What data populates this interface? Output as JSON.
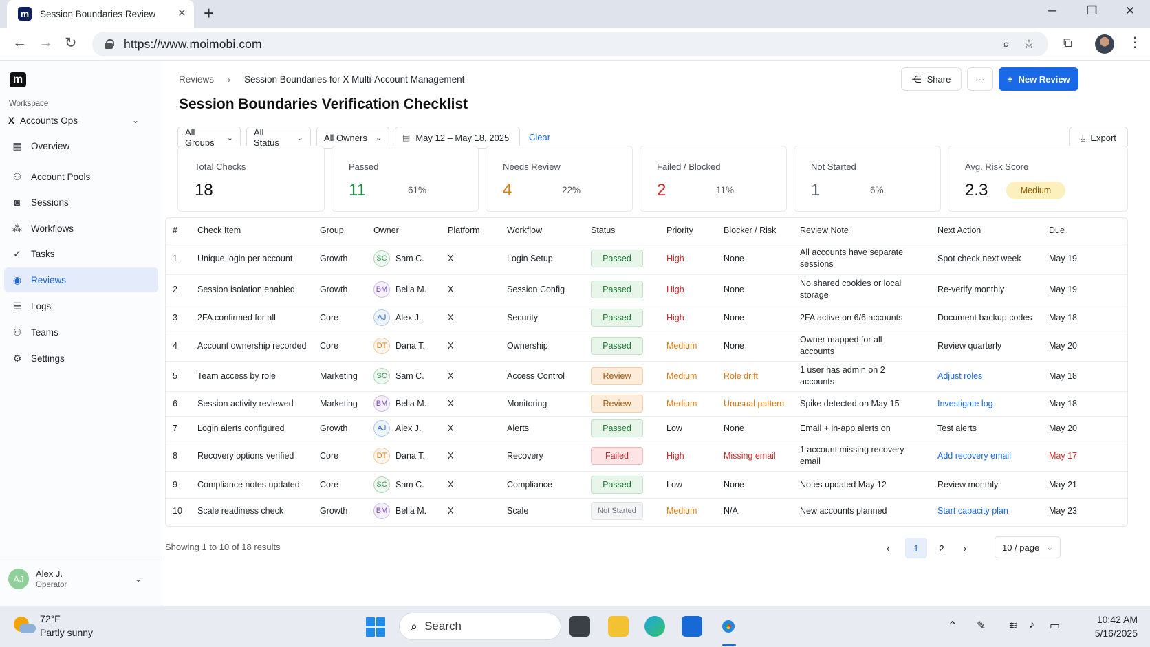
{
  "browser": {
    "tab_title": "Session Boundaries Review",
    "url": "https://www.moimobi.com",
    "favicon_letter": "m"
  },
  "sidebar": {
    "logo_letter": "m",
    "workspace_label": "Workspace",
    "workspace_name": "Accounts Ops",
    "workspace_prefix": "X",
    "items": [
      {
        "label": "Overview",
        "icon": "grid-icon"
      },
      {
        "label": "Account Pools",
        "icon": "users-icon"
      },
      {
        "label": "Sessions",
        "icon": "session-icon"
      },
      {
        "label": "Workflows",
        "icon": "workflow-icon"
      },
      {
        "label": "Tasks",
        "icon": "check-circle-icon"
      },
      {
        "label": "Reviews",
        "icon": "review-icon",
        "active": true
      },
      {
        "label": "Logs",
        "icon": "log-icon"
      },
      {
        "label": "Teams",
        "icon": "team-icon"
      },
      {
        "label": "Settings",
        "icon": "gear-icon"
      }
    ],
    "user": {
      "initials": "AJ",
      "name": "Alex J.",
      "role": "Operator"
    }
  },
  "header": {
    "breadcrumb_root": "Reviews",
    "breadcrumb_current": "Session Boundaries for X Multi-Account Management",
    "title": "Session Boundaries Verification Checklist",
    "share_label": "Share",
    "more_label": "···",
    "new_review_label": "New Review",
    "export_label": "Export"
  },
  "filters": {
    "groups": "All Groups",
    "status": "All Status",
    "owners": "All Owners",
    "date_range": "May 12 – May 18, 2025",
    "clear": "Clear"
  },
  "summary": [
    {
      "label": "Total Checks",
      "value": "18",
      "pct": "",
      "color": "#111111"
    },
    {
      "label": "Passed",
      "value": "11",
      "pct": "61%",
      "color": "#1b8a3a"
    },
    {
      "label": "Needs Review",
      "value": "4",
      "pct": "22%",
      "color": "#e07b12"
    },
    {
      "label": "Failed / Blocked",
      "value": "2",
      "pct": "11%",
      "color": "#d42a2a"
    },
    {
      "label": "Not Started",
      "value": "1",
      "pct": "6%",
      "color": "#5a6270"
    },
    {
      "label": "Avg. Risk Score",
      "value": "2.3",
      "badge": "Medium",
      "color": "#111111"
    }
  ],
  "table": {
    "columns": [
      "#",
      "Check Item",
      "Group",
      "Owner",
      "Platform",
      "Workflow",
      "Status",
      "Priority",
      "Blocker / Risk",
      "Review Note",
      "Next Action",
      "Due"
    ],
    "rows": [
      {
        "n": "1",
        "item": "Unique login per account",
        "group": "Growth",
        "initials": "SC",
        "owner": "Sam C.",
        "platform": "X",
        "workflow": "Login Setup",
        "status": "Passed",
        "status_class": "passed",
        "priority": "High",
        "blocker": "None",
        "note": "All accounts have separate sessions",
        "action": "Spot check next week",
        "action_link": false,
        "due": "May 19",
        "due_alert": false
      },
      {
        "n": "2",
        "item": "Session isolation enabled",
        "group": "Growth",
        "initials": "BM",
        "owner": "Bella M.",
        "platform": "X",
        "workflow": "Session Config",
        "status": "Passed",
        "status_class": "passed",
        "priority": "High",
        "blocker": "None",
        "note": "No shared cookies or local storage",
        "action": "Re-verify monthly",
        "action_link": false,
        "due": "May 19",
        "due_alert": false
      },
      {
        "n": "3",
        "item": "2FA confirmed for all",
        "group": "Core",
        "initials": "AJ",
        "owner": "Alex J.",
        "platform": "X",
        "workflow": "Security",
        "status": "Passed",
        "status_class": "passed",
        "priority": "High",
        "blocker": "None",
        "note": "2FA active on 6/6 accounts",
        "action": "Document backup codes",
        "action_link": false,
        "due": "May 18",
        "due_alert": false
      },
      {
        "n": "4",
        "item": "Account ownership recorded",
        "group": "Core",
        "initials": "DT",
        "owner": "Dana T.",
        "platform": "X",
        "workflow": "Ownership",
        "status": "Passed",
        "status_class": "passed",
        "priority": "Medium",
        "blocker": "None",
        "note": "Owner mapped for all accounts",
        "action": "Review quarterly",
        "action_link": false,
        "due": "May 20",
        "due_alert": false
      },
      {
        "n": "5",
        "item": "Team access by role",
        "group": "Marketing",
        "initials": "SC",
        "owner": "Sam C.",
        "platform": "X",
        "workflow": "Access Control",
        "status": "Review",
        "status_class": "review",
        "priority": "Medium",
        "blocker": "Role drift",
        "note": "1 user has admin on 2 accounts",
        "action": "Adjust roles",
        "action_link": true,
        "due": "May 18",
        "due_alert": false
      },
      {
        "n": "6",
        "item": "Session activity reviewed",
        "group": "Marketing",
        "initials": "BM",
        "owner": "Bella M.",
        "platform": "X",
        "workflow": "Monitoring",
        "status": "Review",
        "status_class": "review",
        "priority": "Medium",
        "blocker": "Unusual pattern",
        "note": "Spike detected on May 15",
        "action": "Investigate log",
        "action_link": true,
        "due": "May 18",
        "due_alert": false
      },
      {
        "n": "7",
        "item": "Login alerts configured",
        "group": "Growth",
        "initials": "AJ",
        "owner": "Alex J.",
        "platform": "X",
        "workflow": "Alerts",
        "status": "Passed",
        "status_class": "passed",
        "priority": "Low",
        "blocker": "None",
        "note": "Email + in-app alerts on",
        "action": "Test alerts",
        "action_link": false,
        "due": "May 20",
        "due_alert": false
      },
      {
        "n": "8",
        "item": "Recovery options verified",
        "group": "Core",
        "initials": "DT",
        "owner": "Dana T.",
        "platform": "X",
        "workflow": "Recovery",
        "status": "Failed",
        "status_class": "failed",
        "priority": "High",
        "blocker": "Missing email",
        "note": "1 account missing recovery email",
        "action": "Add recovery email",
        "action_link": true,
        "due": "May 17",
        "due_alert": true
      },
      {
        "n": "9",
        "item": "Compliance notes updated",
        "group": "Core",
        "initials": "SC",
        "owner": "Sam C.",
        "platform": "X",
        "workflow": "Compliance",
        "status": "Passed",
        "status_class": "passed",
        "priority": "Low",
        "blocker": "None",
        "note": "Notes updated May 12",
        "action": "Review monthly",
        "action_link": false,
        "due": "May 21",
        "due_alert": false
      },
      {
        "n": "10",
        "item": "Scale readiness check",
        "group": "Growth",
        "initials": "BM",
        "owner": "Bella M.",
        "platform": "X",
        "workflow": "Scale",
        "status": "Not Started",
        "status_class": "notstarted",
        "priority": "Medium",
        "blocker": "N/A",
        "note": "New accounts planned",
        "action": "Start capacity plan",
        "action_link": true,
        "due": "May 23",
        "due_alert": false
      }
    ]
  },
  "pagination": {
    "showing": "Showing 1 to 10 of 18 results",
    "pages": [
      "1",
      "2"
    ],
    "current": "1",
    "per_page": "10 / page"
  },
  "colors": {
    "accent": "#1a6ae8",
    "high": "#d42a2a",
    "medium": "#e07b12",
    "low": "#1f2328",
    "risk_orange": "#e07b12",
    "risk_red": "#d42a2a"
  },
  "initial_colors": {
    "SC": "#2e9a4a",
    "BM": "#7d4bc2",
    "AJ": "#2a6fd6",
    "DT": "#e07b12"
  },
  "taskbar": {
    "temperature": "72°F",
    "condition": "Partly sunny",
    "search": "Search",
    "time": "10:42 AM",
    "date": "5/16/2025"
  }
}
